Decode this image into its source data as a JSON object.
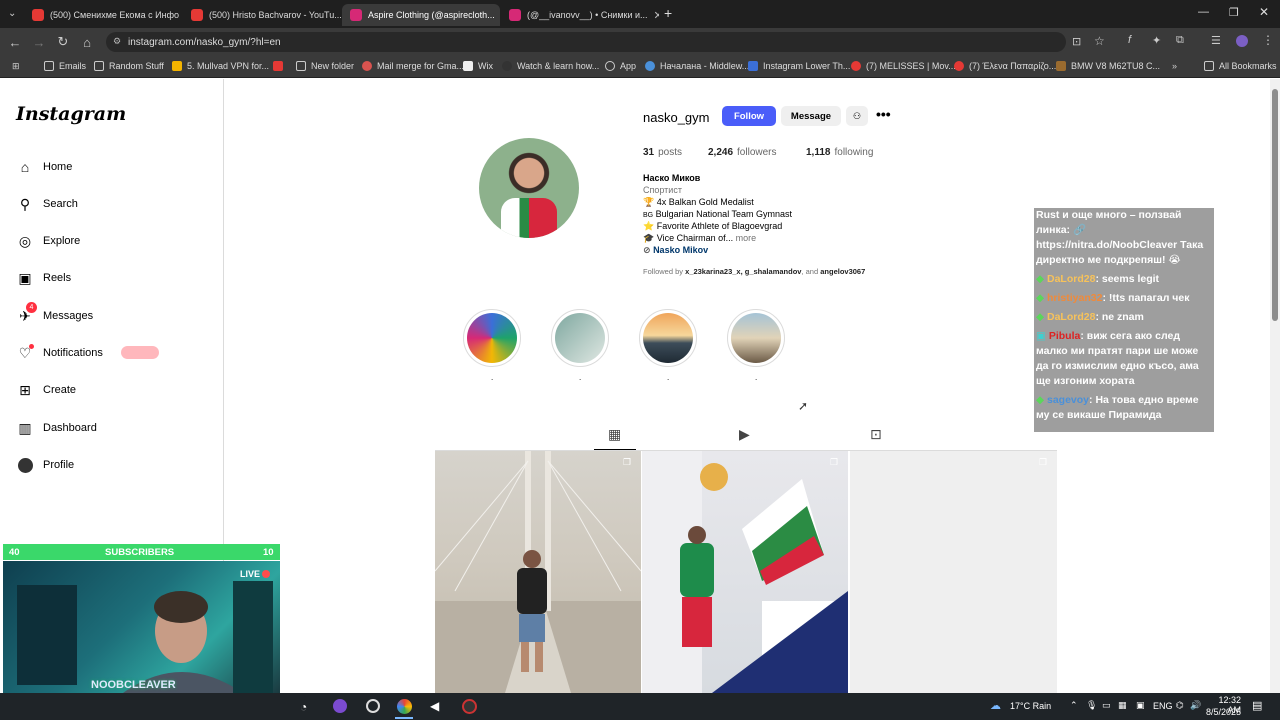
{
  "browser": {
    "tabs": [
      {
        "title": "(500) Сменихме Екома с Инфо П...",
        "color": "#e53935"
      },
      {
        "title": "(500) Hristo Bachvarov - YouTu...",
        "color": "#e53935"
      },
      {
        "title": "Aspire Clothing (@aspirecloth...",
        "color": "#d62976"
      },
      {
        "title": "(@__ivanovv__) • Снимки и...",
        "color": "#d62976"
      }
    ],
    "url": "instagram.com/nasko_gym/?hl=en",
    "bookmarks": [
      "Emails",
      "Random Stuff",
      "5. Mullvad VPN for...",
      "",
      "New folder",
      "Mail merge for Gma...",
      "Wix",
      "Watch & learn how...",
      "App",
      "Началана - Middlew...",
      "Instagram Lower Th...",
      "(7) MELISSES | Mov...",
      "(7) Έλενα Παπαρίζο...",
      "BMW V8 M62TU8 C..."
    ],
    "all_bookmarks": "All Bookmarks"
  },
  "sidebar": {
    "logo": "Instagram",
    "items": [
      {
        "label": "Home",
        "icon": "home-icon"
      },
      {
        "label": "Search",
        "icon": "search-icon"
      },
      {
        "label": "Explore",
        "icon": "explore-icon"
      },
      {
        "label": "Reels",
        "icon": "reels-icon"
      },
      {
        "label": "Messages",
        "icon": "messages-icon",
        "badge": "4"
      },
      {
        "label": "Notifications",
        "icon": "heart-icon"
      },
      {
        "label": "Create",
        "icon": "create-icon"
      },
      {
        "label": "Dashboard",
        "icon": "dashboard-icon"
      },
      {
        "label": "Profile",
        "icon": "profile-icon"
      }
    ]
  },
  "profile": {
    "username": "nasko_gym",
    "follow_label": "Follow",
    "message_label": "Message",
    "posts": {
      "count": "31",
      "label": "posts"
    },
    "followers": {
      "count": "2,246",
      "label": "followers"
    },
    "following": {
      "count": "1,118",
      "label": "following"
    },
    "full_name": "Наско Миков",
    "category": "Спортист",
    "bio": [
      {
        "emoji": "🏆",
        "text": "4x Balkan Gold Medalist"
      },
      {
        "emoji": "BG",
        "text": "Bulgarian National Team Gymnast"
      },
      {
        "emoji": "⭐",
        "text": "Favorite Athlete of Blagoevgrad"
      },
      {
        "emoji": "🎓",
        "text": "Vice Chairman of..."
      }
    ],
    "more": "more",
    "link": "Nasko Mikov",
    "followed_by_prefix": "Followed by",
    "followed_by_names": "x_23karina23_x, g_shalamandov",
    "followed_by_and": ", and",
    "followed_by_last": "angelov3067",
    "highlights": [
      ".",
      ".",
      ".",
      "."
    ]
  },
  "overlay": {
    "chat": [
      {
        "name": "",
        "text": "Rust и още много – ползвай линка: 🔗 https://nitra.do/NoobCleaver Така директно ме подкрепяш! 😭"
      },
      {
        "name": "DaLord28",
        "text": ": seems legit"
      },
      {
        "name": "hristiyan32",
        "text": ": !tts папагал чек"
      },
      {
        "name": "DaLord28",
        "text": ": ne znam"
      },
      {
        "name": "Pibula",
        "text": ": виж сега ако след малко ми пратят пари ше може да го измислим едно късо, ама ще изгоним хората"
      },
      {
        "name": "sagevoy",
        "text": ": На това едно време му се викаше Пирамида"
      }
    ],
    "subs_left": "40",
    "subs_label": "SUBSCRIBERS",
    "subs_right": "10",
    "live": "LIVE",
    "streamer": "NOOBCLEAVER"
  },
  "taskbar": {
    "weather": "17°C  Rain",
    "lang": "ENG",
    "time": "12:32 AM",
    "date": "8/5/2025"
  }
}
